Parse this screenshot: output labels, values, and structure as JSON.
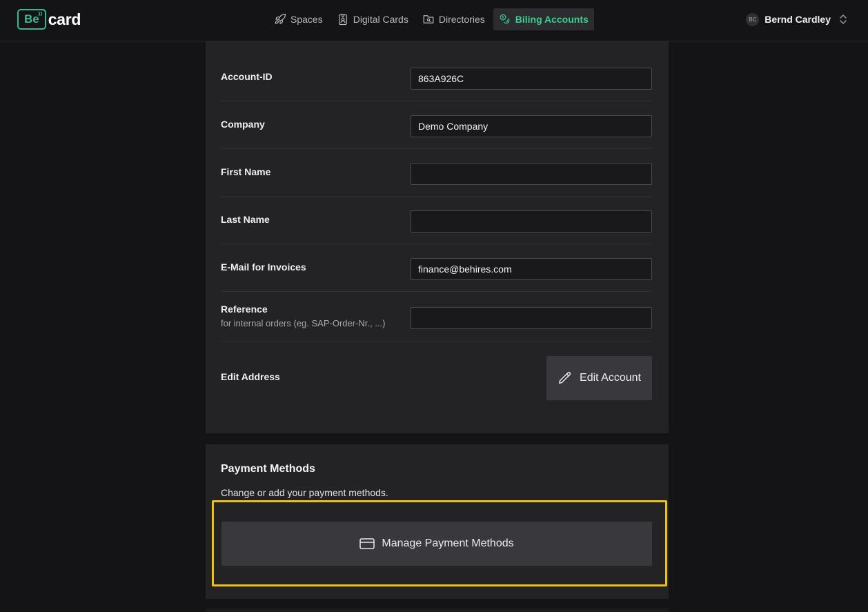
{
  "header": {
    "logo_be": "Be",
    "logo_card": "card",
    "nav": [
      {
        "label": "Spaces",
        "icon": "rocket-icon"
      },
      {
        "label": "Digital Cards",
        "icon": "badge-icon"
      },
      {
        "label": "Directories",
        "icon": "folder-search-icon"
      },
      {
        "label": "Biling Accounts",
        "icon": "coins-icon",
        "active": true
      }
    ],
    "user": {
      "initials": "BC",
      "name": "Bernd Cardley"
    }
  },
  "account": {
    "rows": [
      {
        "label": "Account-ID",
        "value": "863A926C"
      },
      {
        "label": "Company",
        "value": "Demo Company"
      },
      {
        "label": "First Name",
        "value": ""
      },
      {
        "label": "Last Name",
        "value": ""
      },
      {
        "label": "E-Mail for Invoices",
        "value": "finance@behires.com"
      },
      {
        "label": "Reference",
        "sublabel": "for internal orders (eg. SAP-Order-Nr., ...)",
        "value": ""
      }
    ],
    "edit_address_label": "Edit Address",
    "edit_button_label": "Edit Account"
  },
  "payment": {
    "title": "Payment Methods",
    "description": "Change or add your payment methods.",
    "manage_button_label": "Manage Payment Methods"
  },
  "colors": {
    "accent": "#3ad08f",
    "highlight": "#f2c400",
    "background": "#141416",
    "card": "#232326"
  }
}
